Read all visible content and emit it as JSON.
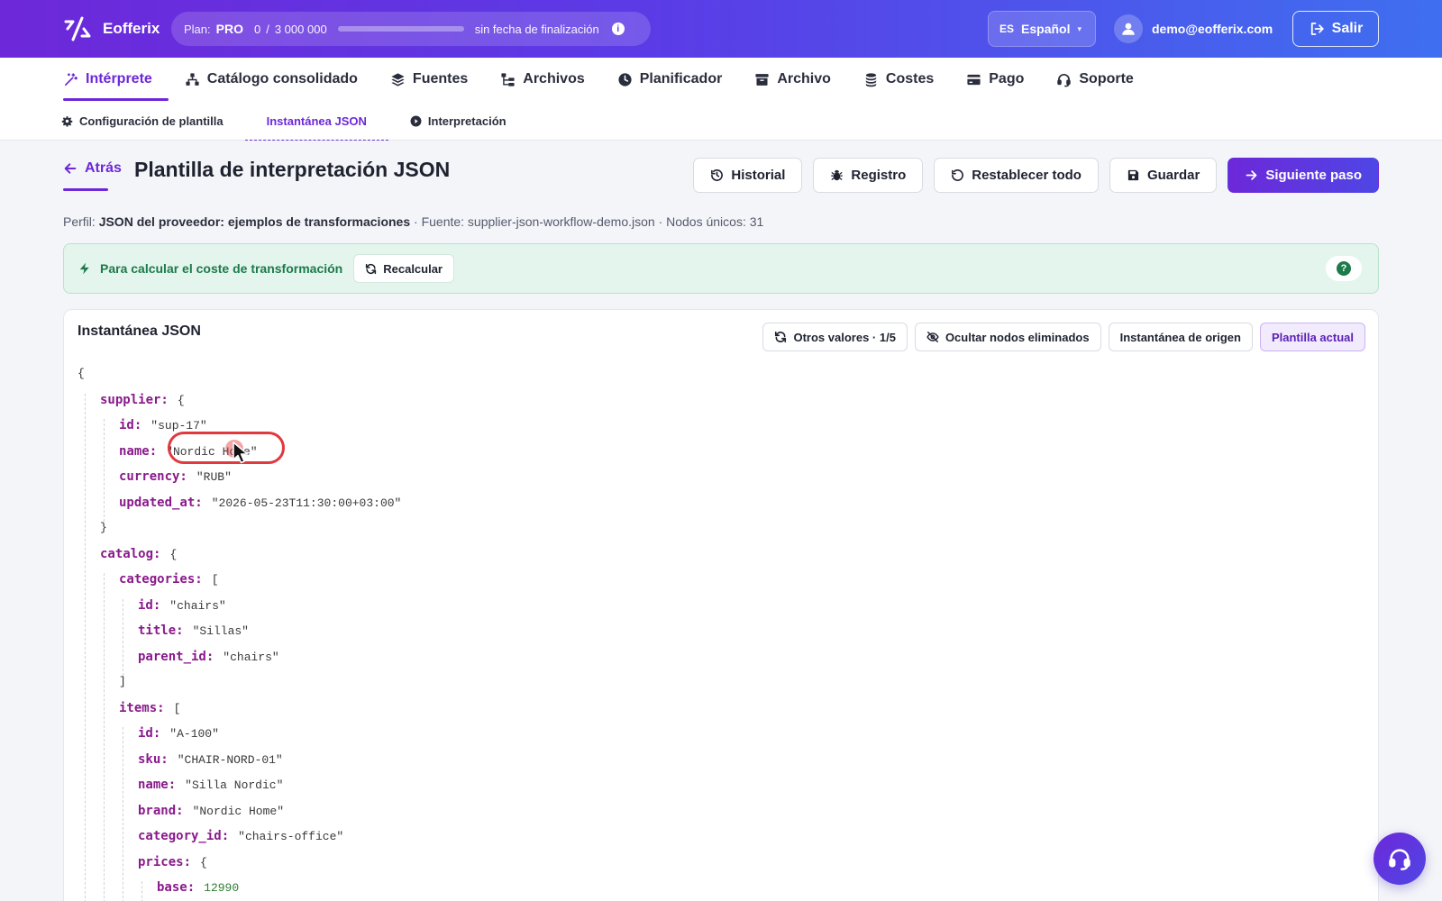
{
  "app": {
    "name": "Eofferix"
  },
  "plan": {
    "label": "Plan:",
    "name": "PRO",
    "used": "0",
    "separator": "/",
    "total": "3 000 000",
    "usage_fraction": 0.0,
    "end": "sin fecha de finalización"
  },
  "language": {
    "code": "ES",
    "name": "Español",
    "caret": "▾"
  },
  "user": {
    "email": "demo@eofferix.com"
  },
  "logout_label": "Salir",
  "nav": {
    "items": [
      {
        "label": "Intérprete",
        "icon": "magic-wand-icon",
        "active": true
      },
      {
        "label": "Catálogo consolidado",
        "icon": "sitemap-icon"
      },
      {
        "label": "Fuentes",
        "icon": "layers-icon"
      },
      {
        "label": "Archivos",
        "icon": "folder-tree-icon"
      },
      {
        "label": "Planificador",
        "icon": "clock-icon"
      },
      {
        "label": "Archivo",
        "icon": "archive-icon"
      },
      {
        "label": "Costes",
        "icon": "coins-icon"
      },
      {
        "label": "Pago",
        "icon": "credit-card-icon"
      },
      {
        "label": "Soporte",
        "icon": "headset-icon"
      }
    ],
    "subitems": [
      {
        "label": "Configuración de plantilla",
        "icon": "gear-icon"
      },
      {
        "label": "Instantánea JSON",
        "active": true
      },
      {
        "label": "Interpretación",
        "icon": "play-circle-icon"
      }
    ]
  },
  "page": {
    "back_label": "Atrás",
    "title": "Plantilla de interpretación JSON",
    "actions": {
      "history": "Historial",
      "log": "Registro",
      "reset": "Restablecer todo",
      "save": "Guardar",
      "next": "Siguiente paso"
    },
    "profile_prefix": "Perfil:",
    "profile_name": "JSON del proveedor: ejemplos de transformaciones",
    "profile_rest": " · Fuente: supplier-json-workflow-demo.json · Nodos únicos: 31"
  },
  "notice": {
    "text": "Para calcular el coste de transformación",
    "button": "Recalcular",
    "help": "?"
  },
  "panel": {
    "title": "Instantánea JSON",
    "buttons": {
      "other_values": "Otros valores · 1/5",
      "hide_deleted": "Ocultar nodos eliminados",
      "source_snapshot": "Instantánea de origen",
      "current_template": "Plantilla actual"
    }
  },
  "json_lines": [
    {
      "type": "brace",
      "text": "{",
      "indent": 0
    },
    {
      "key": "supplier:",
      "val": "{",
      "vtype": "brace",
      "indent": 1
    },
    {
      "key": "id:",
      "val": "\"sup-17\"",
      "vtype": "str",
      "indent": 2
    },
    {
      "key": "name:",
      "val": "\"Nordic Home\"",
      "vtype": "str",
      "indent": 2
    },
    {
      "key": "currency:",
      "val": "\"RUB\"",
      "vtype": "str",
      "indent": 2
    },
    {
      "key": "updated_at:",
      "val": "\"2026-05-23T11:30:00+03:00\"",
      "vtype": "str",
      "indent": 2
    },
    {
      "type": "brace",
      "text": "}",
      "indent": 1
    },
    {
      "key": "catalog:",
      "val": "{",
      "vtype": "brace",
      "indent": 1
    },
    {
      "key": "categories:",
      "val": "[",
      "vtype": "brace",
      "indent": 2
    },
    {
      "key": "id:",
      "val": "\"chairs\"",
      "vtype": "str",
      "indent": 3
    },
    {
      "key": "title:",
      "val": "\"Sillas\"",
      "vtype": "str",
      "indent": 3
    },
    {
      "key": "parent_id:",
      "val": "\"chairs\"",
      "vtype": "str",
      "indent": 3
    },
    {
      "type": "brace",
      "text": "]",
      "indent": 2
    },
    {
      "key": "items:",
      "val": "[",
      "vtype": "brace",
      "indent": 2
    },
    {
      "key": "id:",
      "val": "\"A-100\"",
      "vtype": "str",
      "indent": 3
    },
    {
      "key": "sku:",
      "val": "\"CHAIR-NORD-01\"",
      "vtype": "str",
      "indent": 3
    },
    {
      "key": "name:",
      "val": "\"Silla Nordic\"",
      "vtype": "str",
      "indent": 3
    },
    {
      "key": "brand:",
      "val": "\"Nordic Home\"",
      "vtype": "str",
      "indent": 3
    },
    {
      "key": "category_id:",
      "val": "\"chairs-office\"",
      "vtype": "str",
      "indent": 3
    },
    {
      "key": "prices:",
      "val": "{",
      "vtype": "brace",
      "indent": 3
    },
    {
      "key": "base:",
      "val": "12990",
      "vtype": "num",
      "indent": 4
    }
  ],
  "colors": {
    "accent": "#6d28d9",
    "success": "#1c7a4b",
    "highlight": "#e0393e"
  }
}
